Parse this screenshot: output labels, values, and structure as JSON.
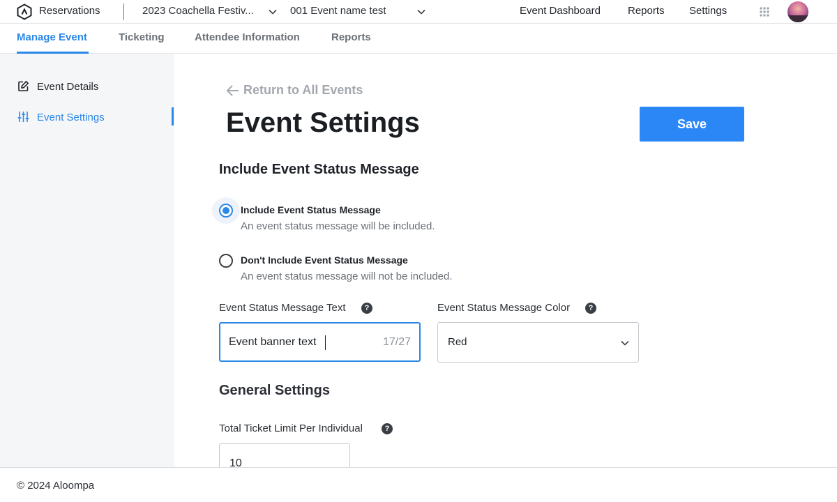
{
  "header": {
    "app_name": "Reservations",
    "festival_select": "2023 Coachella Festiv...",
    "event_select": "001 Event name test",
    "links": {
      "dashboard": "Event Dashboard",
      "reports": "Reports",
      "settings": "Settings"
    }
  },
  "tabs": {
    "manage": "Manage Event",
    "ticketing": "Ticketing",
    "attendee": "Attendee Information",
    "reports": "Reports",
    "active": "Manage Event"
  },
  "sidebar": {
    "items": [
      {
        "label": "Event Details",
        "icon": "edit-icon"
      },
      {
        "label": "Event Settings",
        "icon": "sliders-icon",
        "active": true
      }
    ]
  },
  "main": {
    "back_label": "Return to All Events",
    "page_title": "Event Settings",
    "save_label": "Save",
    "status_section": {
      "title": "Include Event Status Message",
      "options": [
        {
          "title": "Include Event Status Message",
          "description": "An event status message will be included.",
          "checked": true
        },
        {
          "title": "Don't Include Event Status Message",
          "description": "An event status message will not be included.",
          "checked": false
        }
      ],
      "text_field": {
        "label": "Event Status Message Text",
        "value": "Event banner text",
        "counter": "17/27"
      },
      "color_field": {
        "label": "Event Status Message Color",
        "value": "Red"
      }
    },
    "general_section": {
      "title": "General Settings",
      "limit_field": {
        "label": "Total Ticket Limit Per Individual",
        "value": "10"
      }
    }
  },
  "footer": {
    "text": "© 2024 Aloompa"
  },
  "colors": {
    "accent": "#2b87e8",
    "button": "#2b87f5",
    "sidebar_bg": "#f5f6f8"
  }
}
